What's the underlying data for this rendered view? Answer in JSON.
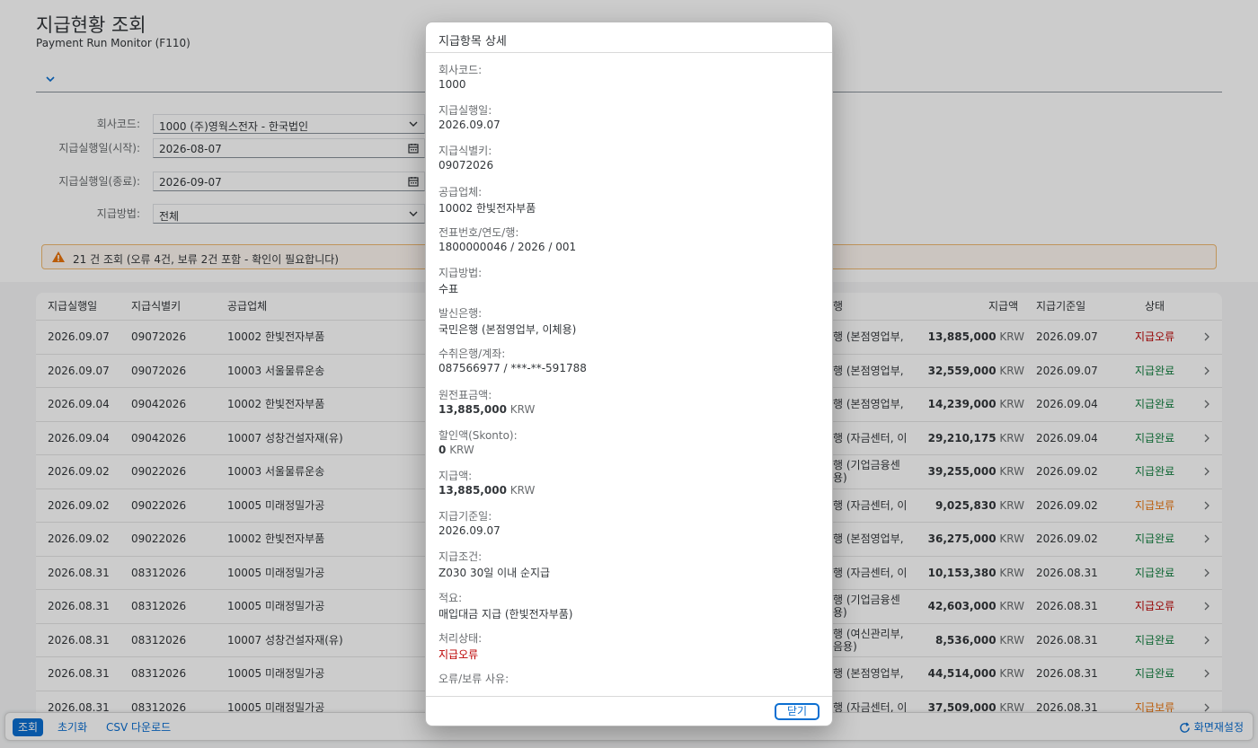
{
  "page": {
    "title": "지급현황 조회",
    "subtitle": "Payment Run Monitor (F110)"
  },
  "filters": [
    {
      "label": "회사코드:",
      "value": "1000 (주)영웍스전자 - 한국법인",
      "kind": "select"
    },
    {
      "label": "지급실행일(시작):",
      "value": "2026-08-07",
      "kind": "date"
    },
    {
      "label": "지급실행일(종료):",
      "value": "2026-09-07",
      "kind": "date"
    },
    {
      "label": "지급방법:",
      "value": "전체",
      "kind": "select"
    }
  ],
  "message": "21 건 조회 (오류 4건, 보류 2건 포함 - 확인이 필요합니다)",
  "table": {
    "headers": {
      "date": "지급실행일",
      "runid": "지급식별키",
      "vendor": "공급업체",
      "bank": "행",
      "amount": "지급액",
      "basedate": "지급기준일",
      "status": "상태"
    },
    "rows": [
      {
        "date": "2026.09.07",
        "runid": "09072026",
        "vendor": "10002 한빛전자부품",
        "bank": "행 (본점영업부,",
        "amount": "13,885,000",
        "currency": "KRW",
        "basedate": "2026.09.07",
        "status": "지급오류",
        "status_type": "err"
      },
      {
        "date": "2026.09.07",
        "runid": "09072026",
        "vendor": "10003 서울물류운송",
        "bank": "행 (본점영업부,",
        "amount": "32,559,000",
        "currency": "KRW",
        "basedate": "2026.09.07",
        "status": "지급완료",
        "status_type": "ok"
      },
      {
        "date": "2026.09.04",
        "runid": "09042026",
        "vendor": "10002 한빛전자부품",
        "bank": "행 (본점영업부,",
        "amount": "14,239,000",
        "currency": "KRW",
        "basedate": "2026.09.04",
        "status": "지급완료",
        "status_type": "ok"
      },
      {
        "date": "2026.09.04",
        "runid": "09042026",
        "vendor": "10007 성창건설자재(유)",
        "bank": "행 (자금센터, 이",
        "amount": "29,210,175",
        "currency": "KRW",
        "basedate": "2026.09.04",
        "status": "지급완료",
        "status_type": "ok"
      },
      {
        "date": "2026.09.02",
        "runid": "09022026",
        "vendor": "10003 서울물류운송",
        "bank": "행 (기업금융센\n용)",
        "amount": "39,255,000",
        "currency": "KRW",
        "basedate": "2026.09.02",
        "status": "지급완료",
        "status_type": "ok"
      },
      {
        "date": "2026.09.02",
        "runid": "09022026",
        "vendor": "10005 미래정밀가공",
        "bank": "행 (자금센터, 이",
        "amount": "9,025,830",
        "currency": "KRW",
        "basedate": "2026.09.02",
        "status": "지급보류",
        "status_type": "hold"
      },
      {
        "date": "2026.09.02",
        "runid": "09022026",
        "vendor": "10002 한빛전자부품",
        "bank": "행 (본점영업부,",
        "amount": "36,275,000",
        "currency": "KRW",
        "basedate": "2026.09.02",
        "status": "지급완료",
        "status_type": "ok"
      },
      {
        "date": "2026.08.31",
        "runid": "08312026",
        "vendor": "10005 미래정밀가공",
        "bank": "행 (자금센터, 이",
        "amount": "10,153,380",
        "currency": "KRW",
        "basedate": "2026.08.31",
        "status": "지급완료",
        "status_type": "ok"
      },
      {
        "date": "2026.08.31",
        "runid": "08312026",
        "vendor": "10005 미래정밀가공",
        "bank": "행 (기업금융센\n용)",
        "amount": "42,603,000",
        "currency": "KRW",
        "basedate": "2026.08.31",
        "status": "지급오류",
        "status_type": "err"
      },
      {
        "date": "2026.08.31",
        "runid": "08312026",
        "vendor": "10007 성창건설자재(유)",
        "bank": "행 (여신관리부,\n음용)",
        "amount": "8,536,000",
        "currency": "KRW",
        "basedate": "2026.08.31",
        "status": "지급완료",
        "status_type": "ok"
      },
      {
        "date": "2026.08.31",
        "runid": "08312026",
        "vendor": "10005 미래정밀가공",
        "bank": "행 (본점영업부,",
        "amount": "44,514,000",
        "currency": "KRW",
        "basedate": "2026.08.31",
        "status": "지급완료",
        "status_type": "ok"
      },
      {
        "date": "2026.08.31",
        "runid": "08312026",
        "vendor": "10005 미래정밀가공",
        "bank": "행 (자금센터, 이",
        "amount": "37,509,000",
        "currency": "KRW",
        "basedate": "2026.08.31",
        "status": "지급보류",
        "status_type": "hold"
      }
    ]
  },
  "footer": {
    "search": "조회",
    "reset": "초기화",
    "csv": "CSV 다운로드",
    "settings": "화면재설정"
  },
  "dialog": {
    "title": "지급항목 상세",
    "fields": [
      {
        "label": "회사코드:",
        "value": "1000"
      },
      {
        "label": "지급실행일:",
        "value": "2026.09.07"
      },
      {
        "label": "지급식별키:",
        "value": "09072026"
      },
      {
        "label": "공급업체:",
        "value": "10002 한빛전자부품"
      },
      {
        "label": "전표번호/연도/행:",
        "value": "1800000046 / 2026 / 001"
      },
      {
        "label": "지급방법:",
        "value": "수표"
      },
      {
        "label": "발신은행:",
        "value": "국민은행 (본점영업부, 이체용)"
      },
      {
        "label": "수취은행/계좌:",
        "value": "087566977 / ***-**-591788"
      },
      {
        "label": "원전표금액:",
        "amount": "13,885,000",
        "currency": "KRW"
      },
      {
        "label": "할인액(Skonto):",
        "amount": "0",
        "currency": "KRW"
      },
      {
        "label": "지급액:",
        "amount": "13,885,000",
        "currency": "KRW"
      },
      {
        "label": "지급기준일:",
        "value": "2026.09.07"
      },
      {
        "label": "지급조건:",
        "value": "Z030 30일 이내 순지급"
      },
      {
        "label": "적요:",
        "value": "매입대금 지급 (한빛전자부품)"
      },
      {
        "label": "처리상태:",
        "value": "지급오류",
        "status_type": "err"
      },
      {
        "label": "오류/보류 사유:",
        "value": ""
      }
    ],
    "close": "닫기"
  },
  "colors": {
    "accent": "#0a6ed1",
    "error": "#bb0000",
    "success": "#107e3e",
    "warning": "#e9730c"
  }
}
